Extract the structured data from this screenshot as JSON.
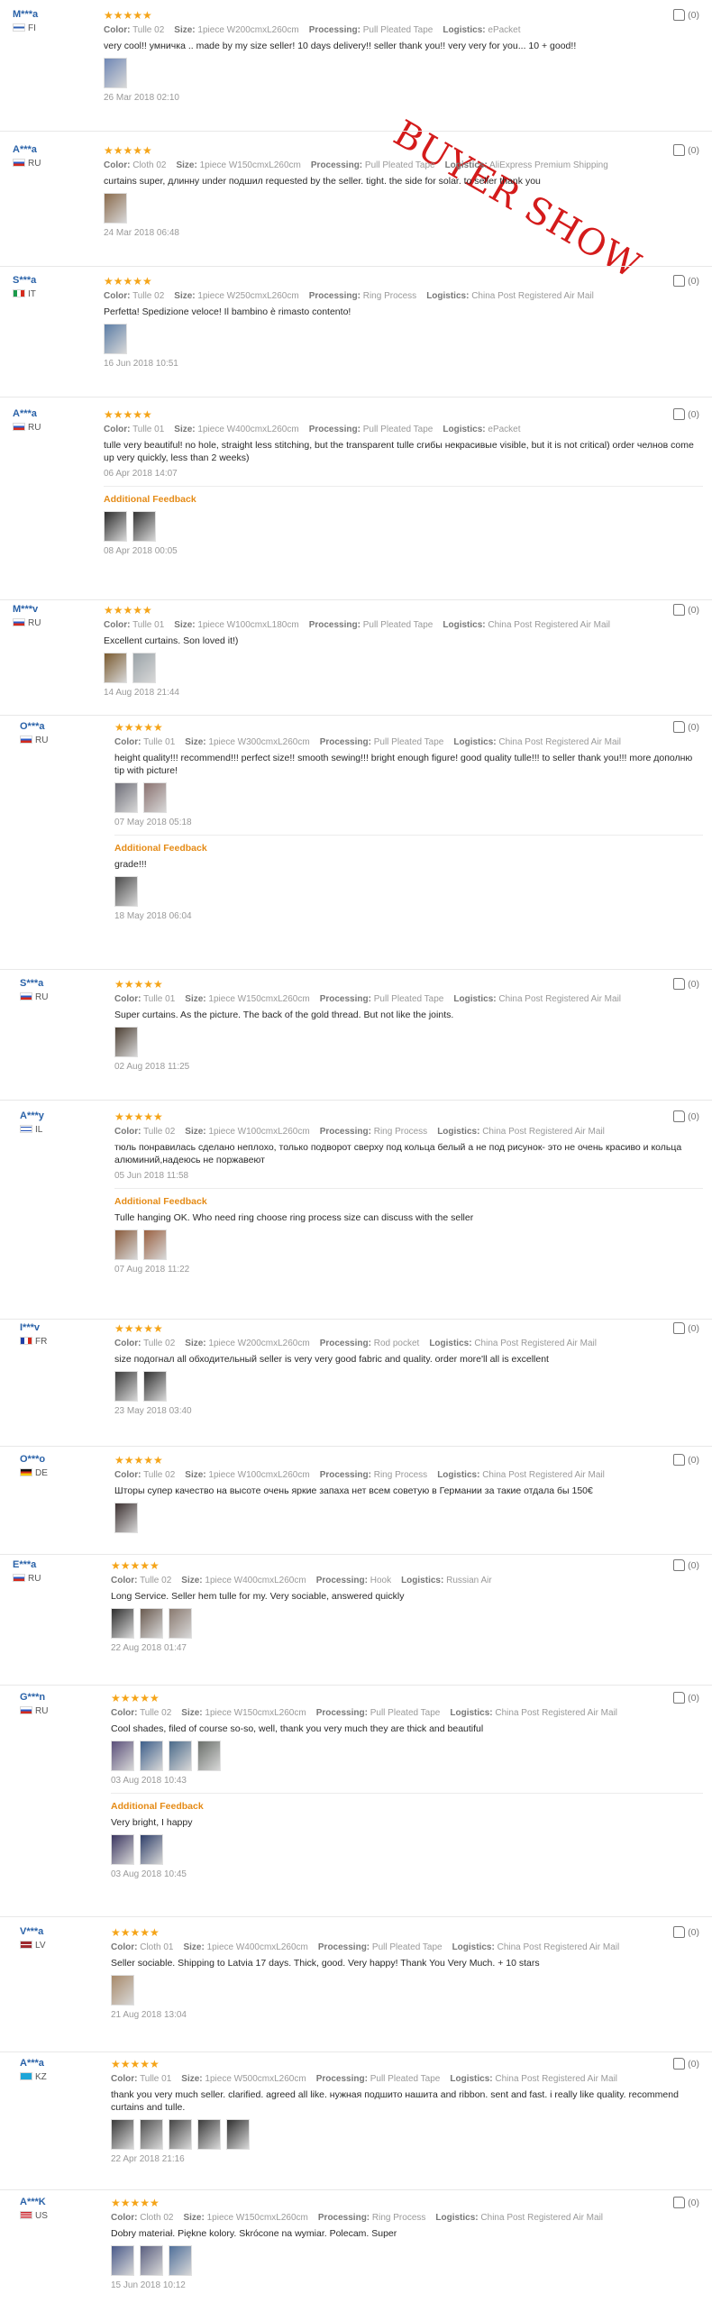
{
  "labels": {
    "color": "Color:",
    "size": "Size:",
    "processing": "Processing:",
    "logistics": "Logistics:",
    "additional_feedback": "Additional Feedback"
  },
  "watermark": "BUYER SHOW",
  "accent_colors": {
    "stars": "#f5a418",
    "username": "#2a62a8",
    "additional_feedback": "#e58b16",
    "watermark": "#d41b1b"
  },
  "reviews": [
    {
      "user": "M***a",
      "country": "FI",
      "stars": "★★★★★",
      "rating": 5,
      "color": "Tulle 02",
      "size": "1piece W200cmxL260cm",
      "processing": "Pull Pleated Tape",
      "logistics": "ePacket",
      "text": "very cool!! умничка .. made by my size seller! 10 days delivery!! seller thank you!! very very for you... 10 + good!!",
      "photos": [
        "#6f87b5"
      ],
      "date": "26 Mar 2018 02:10",
      "helpful": "(0)"
    },
    {
      "user": "A***a",
      "country": "RU",
      "stars": "★★★★★",
      "rating": 5,
      "color": "Cloth 02",
      "size": "1piece W150cmxL260cm",
      "processing": "Pull Pleated Tape",
      "logistics": "AliExpress Premium Shipping",
      "text": "curtains super, длинну under подшил requested by the seller. tight. the side for solar. to seller thank you",
      "photos": [
        "#8a6a4b"
      ],
      "date": "24 Mar 2018 06:48",
      "helpful": "(0)"
    },
    {
      "user": "S***a",
      "country": "IT",
      "stars": "★★★★★",
      "rating": 5,
      "color": "Tulle 02",
      "size": "1piece W250cmxL260cm",
      "processing": "Ring Process",
      "logistics": "China Post Registered Air Mail",
      "text": "Perfetta! Spedizione veloce! Il bambino è rimasto contento!",
      "photos": [
        "#5b7da6"
      ],
      "date": "16 Jun 2018 10:51",
      "helpful": "(0)"
    },
    {
      "user": "A***a",
      "country": "RU",
      "stars": "★★★★★",
      "rating": 5,
      "color": "Tulle 01",
      "size": "1piece W400cmxL260cm",
      "processing": "Pull Pleated Tape",
      "logistics": "ePacket",
      "text": "tulle very beautiful! no hole, straight less stitching, but the transparent tulle сгибы некрасивые visible, but it is not critical) order челнов come up very quickly, less than 2 weeks)",
      "photos": [],
      "date": "06 Apr 2018 14:07",
      "helpful": "(0)",
      "additional": {
        "text": "",
        "photos": [
          "#2b2b2b",
          "#333333"
        ],
        "date": "08 Apr 2018 00:05"
      }
    },
    {
      "user": "M***v",
      "country": "RU",
      "stars": "★★★★★",
      "rating": 5,
      "color": "Tulle 01",
      "size": "1piece W100cmxL180cm",
      "processing": "Pull Pleated Tape",
      "logistics": "China Post Registered Air Mail",
      "text": "Excellent curtains. Son loved it!)",
      "photos": [
        "#7a5a2e",
        "#9aa3a8"
      ],
      "date": "14 Aug 2018 21:44",
      "helpful": "(0)"
    },
    {
      "user": "O***a",
      "country": "RU",
      "stars": "★★★★★",
      "rating": 5,
      "color": "Tulle 01",
      "size": "1piece W300cmxL260cm",
      "processing": "Pull Pleated Tape",
      "logistics": "China Post Registered Air Mail",
      "text": "height quality!!! recommend!!! perfect size!! smooth sewing!!! bright enough figure! good quality tulle!!! to seller thank you!!! more дополню tip with picture!",
      "photos": [
        "#6e6e78",
        "#8a7270"
      ],
      "date": "07 May 2018 05:18",
      "helpful": "(0)",
      "additional": {
        "text": "grade!!!",
        "photos": [
          "#4a4a4a"
        ],
        "date": "18 May 2018 06:04"
      }
    },
    {
      "user": "S***a",
      "country": "RU",
      "stars": "★★★★★",
      "rating": 5,
      "color": "Tulle 01",
      "size": "1piece W150cmxL260cm",
      "processing": "Pull Pleated Tape",
      "logistics": "China Post Registered Air Mail",
      "text": "Super curtains. As the picture. The back of the gold thread. But not like the joints.",
      "photos": [
        "#4c3f33"
      ],
      "date": "02 Aug 2018 11:25",
      "helpful": "(0)"
    },
    {
      "user": "A***y",
      "country": "IL",
      "stars": "★★★★★",
      "rating": 5,
      "color": "Tulle 02",
      "size": "1piece W100cmxL260cm",
      "processing": "Ring Process",
      "logistics": "China Post Registered Air Mail",
      "text": "тюль понравилась сделано неплохо, только подворот сверху под кольца белый а не под рисунок- это не очень красиво и кольца алюминий,надеюсь не поржавеют",
      "photos": [],
      "date": "05 Jun 2018 11:58",
      "helpful": "(0)",
      "additional": {
        "text": "Tulle hanging OK. Who need ring choose ring process size can discuss with the seller",
        "photos": [
          "#8a5a3a",
          "#9a6040"
        ],
        "date": "07 Aug 2018 11:22"
      }
    },
    {
      "user": "I***v",
      "country": "FR",
      "stars": "★★★★★",
      "rating": 5,
      "color": "Tulle 02",
      "size": "1piece W200cmxL260cm",
      "processing": "Rod pocket",
      "logistics": "China Post Registered Air Mail",
      "text": "size подогнал all обходительный seller is very very good fabric and quality. order more'll all is excellent",
      "photos": [
        "#3a3a3a",
        "#2f2f2f"
      ],
      "date": "23 May 2018 03:40",
      "helpful": "(0)"
    },
    {
      "user": "O***o",
      "country": "DE",
      "stars": "★★★★★",
      "rating": 5,
      "color": "Tulle 02",
      "size": "1piece W100cmxL260cm",
      "processing": "Ring Process",
      "logistics": "China Post Registered Air Mail",
      "text": "Шторы супер качество на высоте очень яркие запаха нет всем советую в Германии за такие отдала бы 150€",
      "photos": [
        "#3b3030"
      ],
      "date": "",
      "helpful": "(0)"
    },
    {
      "user": "E***a",
      "country": "RU",
      "stars": "★★★★★",
      "rating": 5,
      "color": "Tulle 02",
      "size": "1piece W400cmxL260cm",
      "processing": "Hook",
      "logistics": "Russian Air",
      "text": "Long Service. Seller hem tulle for my. Very sociable, answered quickly",
      "photos": [
        "#2e2e2e",
        "#6b5b50",
        "#8a7a70"
      ],
      "date": "22 Aug 2018 01:47",
      "helpful": "(0)"
    },
    {
      "user": "G***n",
      "country": "RU",
      "stars": "★★★★★",
      "rating": 5,
      "color": "Tulle 02",
      "size": "1piece W150cmxL260cm",
      "processing": "Pull Pleated Tape",
      "logistics": "China Post Registered Air Mail",
      "text": "Cool shades, filed of course so-so, well, thank you very much they are thick and beautiful",
      "photos": [
        "#5a4f7a",
        "#3d5f8a",
        "#4a6a8a",
        "#6a6f6a"
      ],
      "date": "03 Aug 2018 10:43",
      "helpful": "(0)",
      "additional": {
        "text": "Very bright, I happy",
        "photos": [
          "#3a3560",
          "#2f3f6a"
        ],
        "date": "03 Aug 2018 10:45"
      }
    },
    {
      "user": "V***a",
      "country": "LV",
      "stars": "★★★★★",
      "rating": 5,
      "color": "Cloth 01",
      "size": "1piece W400cmxL260cm",
      "processing": "Pull Pleated Tape",
      "logistics": "China Post Registered Air Mail",
      "text": "Seller sociable. Shipping to Latvia 17 days. Thick, good. Very happy! Thank You Very Much. + 10 stars",
      "photos": [
        "#a88a6a"
      ],
      "date": "21 Aug 2018 13:04",
      "helpful": "(0)"
    },
    {
      "user": "A***a",
      "country": "KZ",
      "stars": "★★★★★",
      "rating": 5,
      "color": "Tulle 01",
      "size": "1piece W500cmxL260cm",
      "processing": "Pull Pleated Tape",
      "logistics": "China Post Registered Air Mail",
      "text": "thank you very much seller. clarified. agreed all like. нужная подшито нашита and ribbon. sent and fast. i really like quality. recommend curtains and tulle.",
      "photos": [
        "#3a3a3a",
        "#505050",
        "#444444",
        "#3a3a3a",
        "#2e2e2e"
      ],
      "date": "22 Apr 2018 21:16",
      "helpful": "(0)"
    },
    {
      "user": "A***K",
      "country": "US",
      "stars": "★★★★★",
      "rating": 5,
      "color": "Cloth 02",
      "size": "1piece W150cmxL260cm",
      "processing": "Ring Process",
      "logistics": "China Post Registered Air Mail",
      "text": "Dobry materiał. Piękne kolory. Skrócone na wymiar. Polecam. Super",
      "photos": [
        "#4a5a8a",
        "#5a5f80",
        "#4f6f9a"
      ],
      "date": "15 Jun 2018 10:12",
      "helpful": "(0)"
    }
  ]
}
